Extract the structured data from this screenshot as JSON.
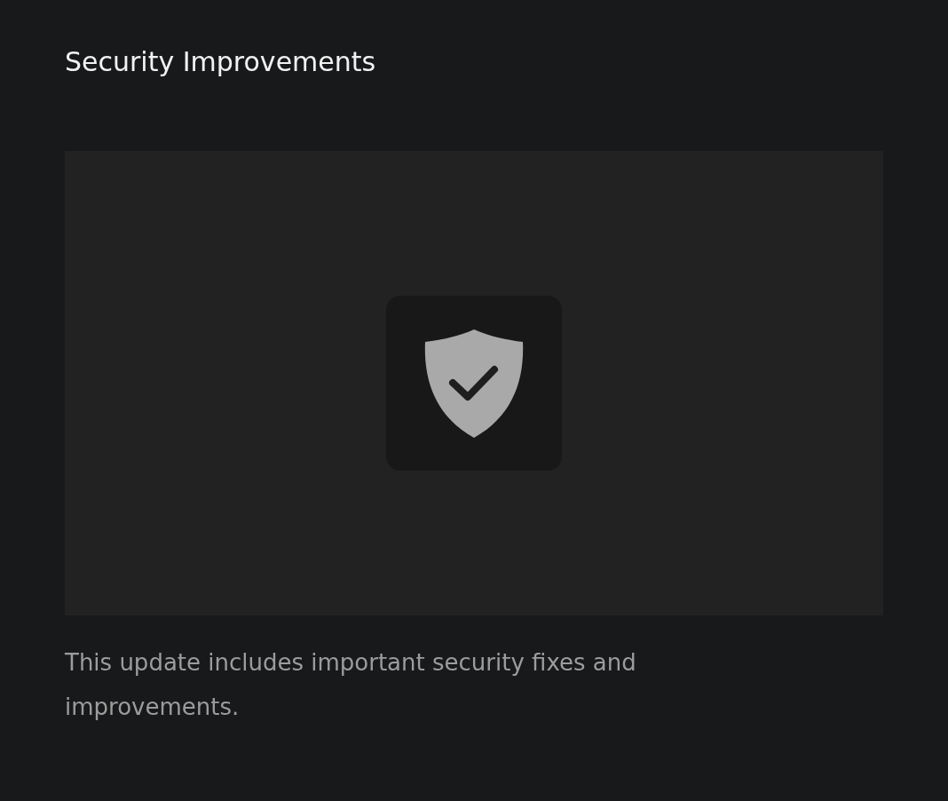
{
  "title": "Security Improvements",
  "description": "This update includes important security fixes and improvements."
}
